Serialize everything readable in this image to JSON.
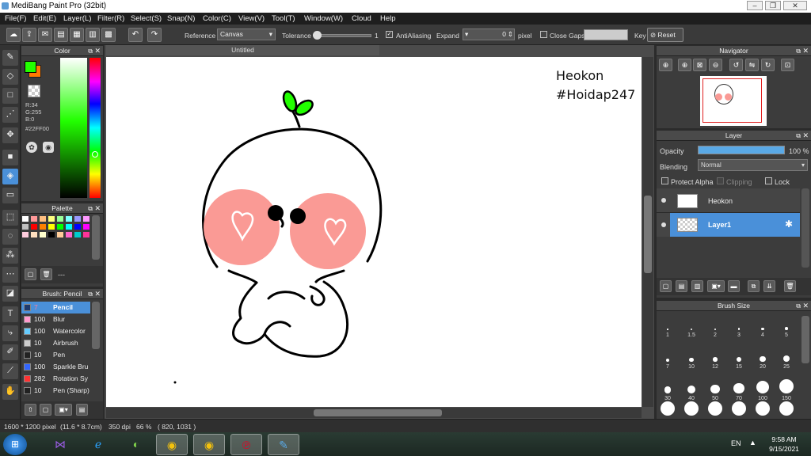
{
  "window": {
    "title": "MediBang Paint Pro (32bit)"
  },
  "menu": [
    "File(F)",
    "Edit(E)",
    "Layer(L)",
    "Filter(R)",
    "Select(S)",
    "Snap(N)",
    "Color(C)",
    "View(V)",
    "Tool(T)",
    "Window(W)",
    "Cloud",
    "Help"
  ],
  "toolbar": {
    "reference_label": "Reference",
    "reference_value": "Canvas",
    "tolerance_label": "Tolerance",
    "tolerance_value": "1",
    "antialiasing_label": "AntiAliasing",
    "expand_label": "Expand",
    "expand_value": "0",
    "pixel_label": "pixel",
    "close_gaps_label": "Close Gaps",
    "key_label": "Key",
    "reset_label": "Reset"
  },
  "color_panel": {
    "title": "Color",
    "r": "R:34",
    "g": "G:255",
    "b": "B:0",
    "hex": "#22FF00",
    "primary_color": "#22ff00",
    "secondary_color": "#ff7a00"
  },
  "palette_panel": {
    "title": "Palette",
    "footer_text": "---",
    "swatches": [
      "#ffffff",
      "#ff9999",
      "#ffbf80",
      "#ffff80",
      "#99ff99",
      "#80ffff",
      "#9999ff",
      "#ff99ff",
      "#c0c0c0",
      "#ff0000",
      "#ff8000",
      "#ffff00",
      "#00ff00",
      "#00ffff",
      "#0000ff",
      "#ff00ff",
      "#ffccdd",
      "#ffe0c0",
      "#ffffcc",
      "#000000",
      "#ffcc99",
      "#ff66cc",
      "#00cccc",
      "#ff3399"
    ]
  },
  "brush_panel": {
    "title": "Brush: Pencil",
    "brushes": [
      {
        "size": "7",
        "name": "Pencil",
        "color": "#1e3a6e",
        "active": true
      },
      {
        "size": "100",
        "name": "Blur",
        "color": "#ff99cc"
      },
      {
        "size": "100",
        "name": "Watercolor",
        "color": "#66ccff"
      },
      {
        "size": "10",
        "name": "Airbrush",
        "color": "#cccccc"
      },
      {
        "size": "10",
        "name": "Pen",
        "color": "#222222"
      },
      {
        "size": "100",
        "name": "Sparkle Bru",
        "color": "#3366ff"
      },
      {
        "size": "282",
        "name": "Rotation Sy",
        "color": "#ff3333"
      },
      {
        "size": "10",
        "name": "Pen (Sharp)",
        "color": "#222222"
      }
    ]
  },
  "document": {
    "tab_title": "Untitled",
    "canvas_text_1": "Heokon",
    "canvas_text_2": "#Hoidap247",
    "sprout_color": "#22ff00",
    "blush_color": "#fa9a95"
  },
  "navigator_panel": {
    "title": "Navigator"
  },
  "layer_panel": {
    "title": "Layer",
    "opacity_label": "Opacity",
    "opacity_value": "100 %",
    "opacity_fraction": 1.0,
    "blending_label": "Blending",
    "blending_value": "Normal",
    "protect_alpha_label": "Protect Alpha",
    "clipping_label": "Clipping",
    "lock_label": "Lock",
    "layers": [
      {
        "name": "Heokon",
        "selected": false
      },
      {
        "name": "Layer1",
        "selected": true
      }
    ]
  },
  "brush_size_panel": {
    "title": "Brush Size",
    "sizes": [
      "1",
      "1.5",
      "2",
      "3",
      "4",
      "5",
      "7",
      "10",
      "12",
      "15",
      "20",
      "25",
      "30",
      "40",
      "50",
      "70",
      "100",
      "150"
    ]
  },
  "status": {
    "size": "1600 * 1200 pixel",
    "cm": "(11.6 * 8.7cm)",
    "dpi": "350 dpi",
    "zoom": "66 %",
    "coords": "( 820, 1031 )"
  },
  "taskbar": {
    "lang": "EN",
    "time": "9:58 AM",
    "date": "9/15/2021"
  }
}
